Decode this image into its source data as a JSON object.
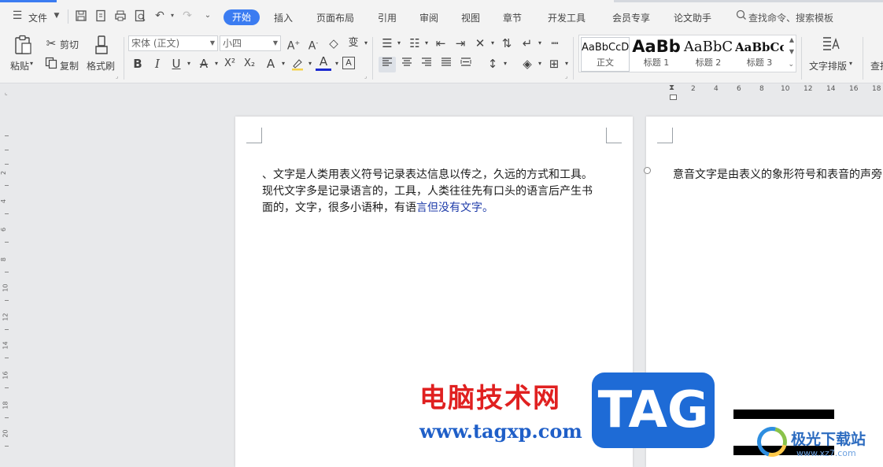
{
  "menubar": {
    "file_label": "文件",
    "tabs": [
      "开始",
      "插入",
      "页面布局",
      "引用",
      "审阅",
      "视图",
      "章节",
      "开发工具",
      "会员专享",
      "论文助手"
    ],
    "search_placeholder": "查找命令、搜索模板"
  },
  "ribbon": {
    "paste": "粘贴",
    "cut": "剪切",
    "copy": "复制",
    "format_painter": "格式刷",
    "font_name": "宋体 (正文)",
    "font_size": "小四",
    "styles": [
      {
        "sample": "AaBbCcD",
        "name": "正文"
      },
      {
        "sample": "AaBb",
        "name": "标题 1"
      },
      {
        "sample": "AaBbC",
        "name": "标题 2"
      },
      {
        "sample": "AaBbCcI",
        "name": "标题 3"
      }
    ],
    "text_layout": "文字排版",
    "find_partial": "查找"
  },
  "ruler": {
    "horizontal": [
      "2",
      "4",
      "6",
      "8",
      "10",
      "12",
      "14",
      "16",
      "18"
    ],
    "vertical": [
      "2",
      "4",
      "6",
      "8",
      "10",
      "12",
      "14",
      "16",
      "18",
      "20"
    ]
  },
  "page1": {
    "line1": "、文字是人类用表义符号记录表达信息以传之，久远的方式和工具。",
    "line2": "现代文字多是记录语言的，工具，人类往往先有口头的语言后产生书",
    "line3_black": "面的，文字，很多小语种，有语",
    "line3_blue": "言但没有文字。"
  },
  "page2": {
    "line1": "意音文字是由表义的象形符号和表音的声旁"
  },
  "watermark": {
    "site_name": "电脑技术网",
    "site_url": "www.tagxp.com",
    "logo_text": "TAG",
    "jg_name": "极光下载站",
    "jg_url": "www.xz7.com"
  },
  "colors": {
    "accent": "#3b7cf1",
    "watermark_red": "#e02020",
    "watermark_blue": "#1f5fc8",
    "logo_blue": "#1e6bd6"
  }
}
